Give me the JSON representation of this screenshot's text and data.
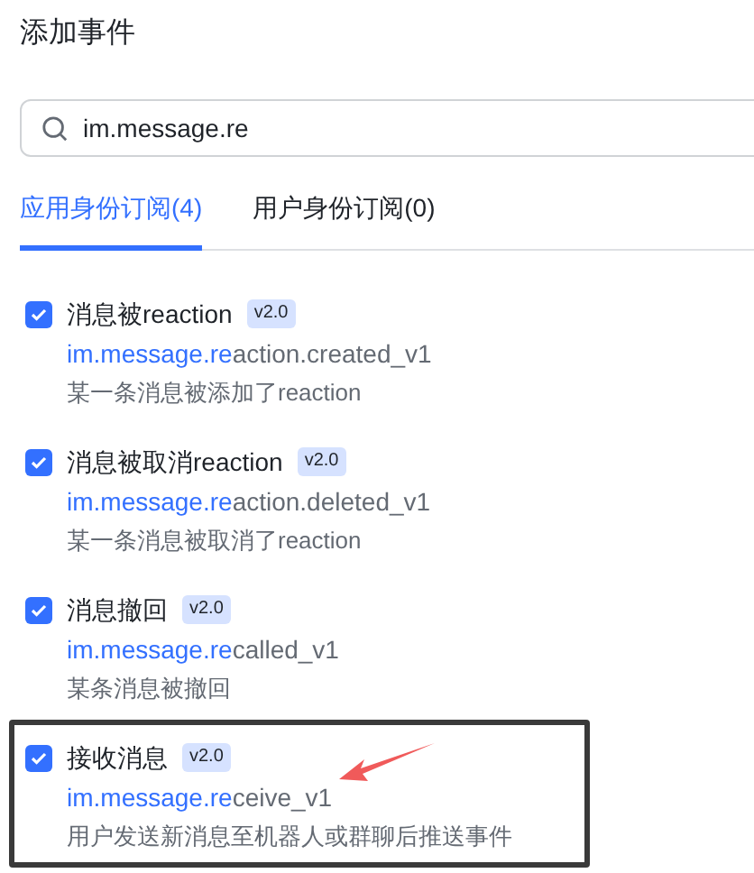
{
  "title": "添加事件",
  "search": {
    "value": "im.message.re"
  },
  "tabs": [
    {
      "label": "应用身份订阅(4)",
      "selected": true
    },
    {
      "label": "用户身份订阅(0)",
      "selected": false
    }
  ],
  "events": [
    {
      "name": "消息被reaction",
      "version": "v2.0",
      "key_match": "im.message.re",
      "key_rest": "action.created_v1",
      "description": "某一条消息被添加了reaction",
      "checked": true,
      "highlighted": false
    },
    {
      "name": "消息被取消reaction",
      "version": "v2.0",
      "key_match": "im.message.re",
      "key_rest": "action.deleted_v1",
      "description": "某一条消息被取消了reaction",
      "checked": true,
      "highlighted": false
    },
    {
      "name": "消息撤回",
      "version": "v2.0",
      "key_match": "im.message.re",
      "key_rest": "called_v1",
      "description": "某条消息被撤回",
      "checked": true,
      "highlighted": false
    },
    {
      "name": "接收消息",
      "version": "v2.0",
      "key_match": "im.message.re",
      "key_rest": "ceive_v1",
      "description": "用户发送新消息至机器人或群聊后推送事件",
      "checked": true,
      "highlighted": true
    }
  ]
}
